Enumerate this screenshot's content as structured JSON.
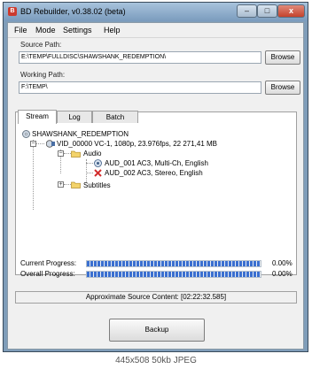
{
  "window": {
    "title": "BD Rebuilder, v0.38.02 (beta)",
    "min": "–",
    "max": "□",
    "close": "x"
  },
  "menu": [
    "File",
    "Mode",
    "Settings",
    "Help"
  ],
  "source": {
    "label": "Source Path:",
    "value": "E:\\TEMP\\FULLDISC\\SHAWSHANK_REDEMPTION\\",
    "browse": "Browse"
  },
  "working": {
    "label": "Working Path:",
    "value": "F:\\TEMP\\",
    "browse": "Browse"
  },
  "tabs": [
    "Stream",
    "Log",
    "Batch"
  ],
  "tree": {
    "root": "SHAWSHANK_REDEMPTION",
    "video": "VID_00000  VC-1, 1080p, 23.976fps, 22 271,41 MB",
    "audio": "Audio",
    "aud1": "AUD_001 AC3, Multi-Ch, English",
    "aud2": "AUD_002 AC3, Stereo, English",
    "subtitles": "Subtitles"
  },
  "progress": {
    "current_label": "Current Progress:",
    "current_pct": "0.00%",
    "current_value": 0,
    "overall_label": "Overall Progress:",
    "overall_pct": "0.00%",
    "overall_value": 0
  },
  "approx": "Approximate Source Content: [02:22:32.585]",
  "backup": "Backup",
  "watermark": "445x508 50kb JPEG"
}
